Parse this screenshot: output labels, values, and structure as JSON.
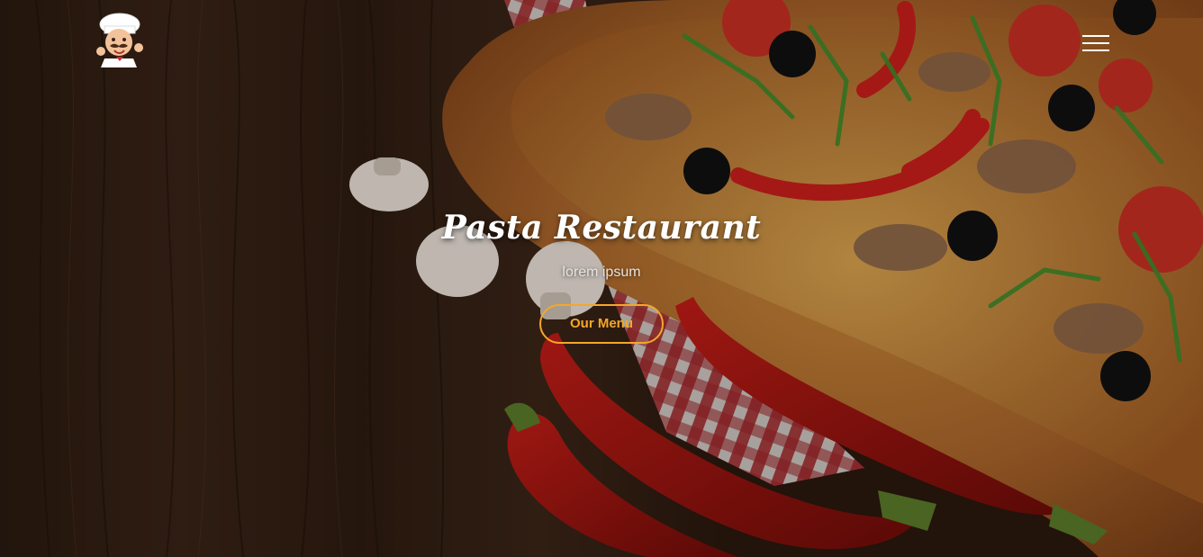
{
  "header": {
    "logo_icon": "chef-mascot-icon",
    "menu_icon": "hamburger-menu-icon"
  },
  "hero": {
    "title": "Pasta Restaurant",
    "subtitle": "lorem ipsum",
    "cta_label": "Our Menu",
    "background": "pizza-on-wooden-table-photo"
  },
  "colors": {
    "accent": "#f4a72a",
    "text": "#ffffff",
    "wood": "#3b2416"
  }
}
